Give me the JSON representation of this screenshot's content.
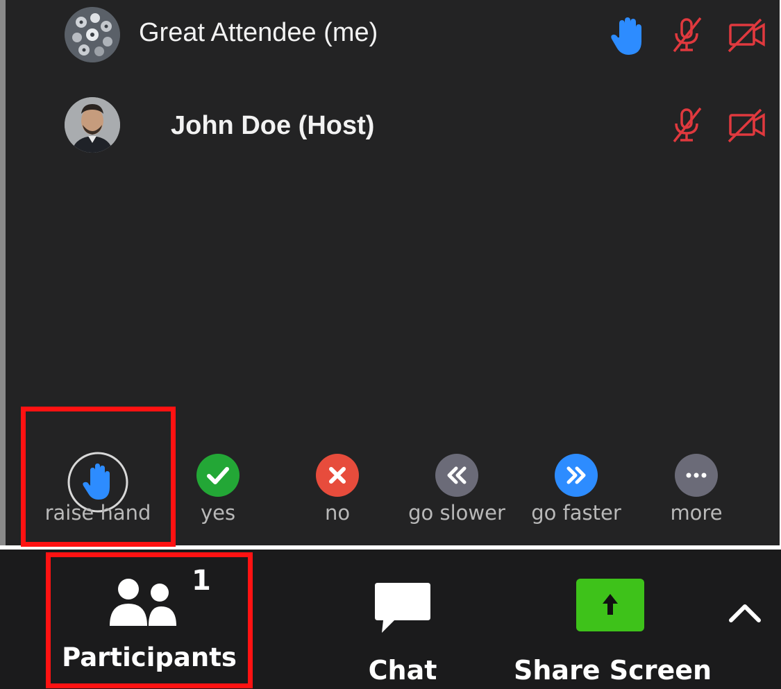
{
  "participants": [
    {
      "name": "Great Attendee (me)",
      "hand_raised": true,
      "mic": "muted",
      "video": "off"
    },
    {
      "name": "John Doe (Host)",
      "hand_raised": false,
      "mic": "muted",
      "video": "off"
    }
  ],
  "reactions": [
    {
      "label": "raise hand",
      "icon": "raise-hand-icon"
    },
    {
      "label": "yes",
      "icon": "check-icon"
    },
    {
      "label": "no",
      "icon": "x-icon"
    },
    {
      "label": "go slower",
      "icon": "rewind-icon"
    },
    {
      "label": "go faster",
      "icon": "fast-forward-icon"
    },
    {
      "label": "more",
      "icon": "ellipsis-icon"
    }
  ],
  "toolbar": {
    "participants_label": "Participants",
    "participants_count": "1",
    "chat_label": "Chat",
    "share_label": "Share Screen"
  },
  "colors": {
    "panel_bg": "#232324",
    "toolbar_bg": "#1b1b1c",
    "hand_blue": "#2d8cff",
    "muted_red": "#e0393e",
    "yes_green": "#23a736",
    "no_red": "#e74c3c",
    "slower_gray": "#6b6b78",
    "faster_blue": "#2d8cff",
    "more_gray": "#6b6b78",
    "share_green": "#3ec21a",
    "highlight_red": "#ff1212"
  }
}
